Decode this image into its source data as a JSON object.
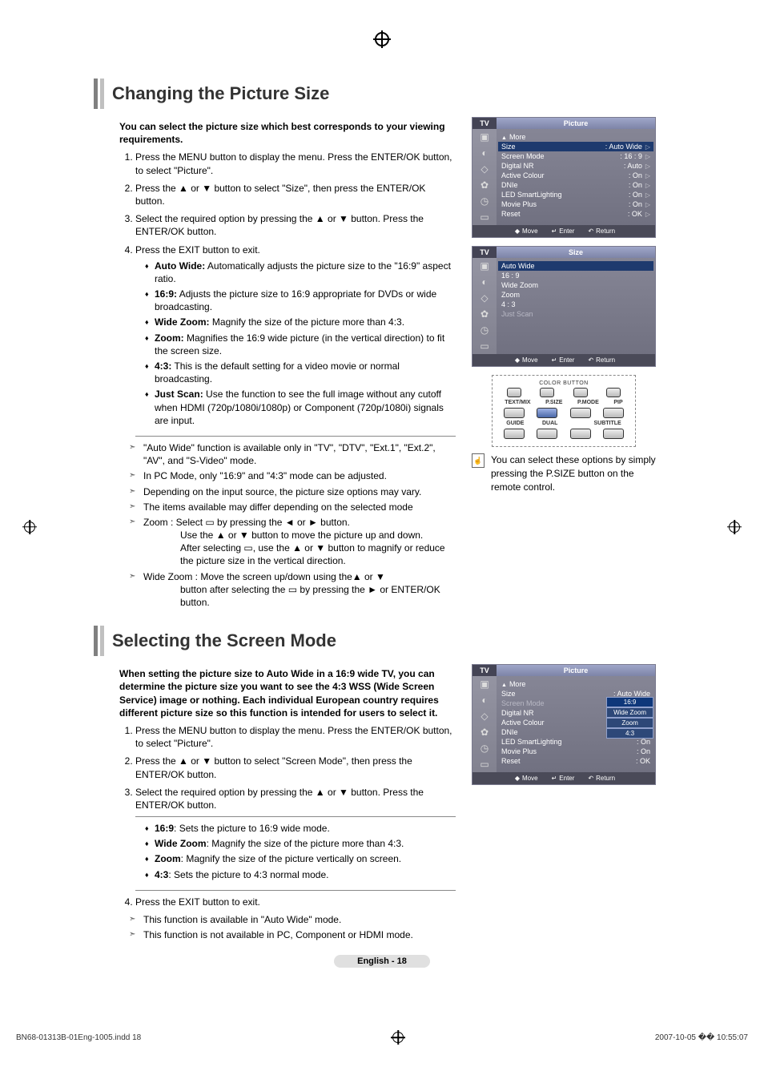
{
  "section1": {
    "title": "Changing the Picture Size",
    "lead": "You can select the picture size which best corresponds to your viewing requirements.",
    "steps": [
      {
        "num": "1.",
        "text": "Press the MENU button to display the menu. Press the ENTER/OK button, to select \"Picture\"."
      },
      {
        "num": "2.",
        "text": "Press the ▲ or ▼ button to select \"Size\", then press the ENTER/OK button."
      },
      {
        "num": "3.",
        "text": "Select the required option by pressing the ▲ or ▼ button. Press the ENTER/OK button."
      },
      {
        "num": "4.",
        "text": "Press the EXIT button to exit."
      }
    ],
    "options": [
      {
        "term": "Auto Wide:",
        "desc": "Automatically adjusts the picture size to the \"16:9\" aspect ratio."
      },
      {
        "term": "16:9:",
        "desc": "Adjusts the picture size to 16:9 appropriate for DVDs or wide broadcasting."
      },
      {
        "term": "Wide Zoom:",
        "desc": "Magnify the size of the picture more than 4:3."
      },
      {
        "term": "Zoom:",
        "desc": "Magnifies the 16:9 wide picture (in the vertical direction) to fit the screen size."
      },
      {
        "term": "4:3:",
        "desc": "This is the default setting for a video movie or normal broadcasting."
      },
      {
        "term": "Just Scan:",
        "desc": "Use the function to see the full image without any cutoff when HDMI (720p/1080i/1080p) or Component (720p/1080i) signals are input."
      }
    ],
    "notes": [
      "\"Auto Wide\" function is available only in \"TV\", \"DTV\",  \"Ext.1\", \"Ext.2\", \"AV\", and \"S-Video\" mode.",
      "In PC Mode, only \"16:9\" and \"4:3\" mode can be adjusted.",
      "Depending on the input source, the picture size options may vary.",
      "The items available may differ depending on the selected mode",
      "Zoom : Select ▭ by pressing the ◄ or ► button.",
      "Wide Zoom : Move the screen up/down using the▲ or ▼"
    ],
    "zoom_extra1": "Use the ▲ or ▼ button to move the picture up and down.",
    "zoom_extra2": "After selecting ▭, use the ▲ or ▼ button to magnify or reduce the picture size in the vertical direction.",
    "widezoom_extra": "button after selecting the ▭ by pressing the ► or ENTER/OK button."
  },
  "osd1": {
    "tab": "TV",
    "title": "Picture",
    "more": "More",
    "rows": [
      {
        "lbl": "Size",
        "val": "Auto Wide"
      },
      {
        "lbl": "Screen Mode",
        "val": "16 : 9"
      },
      {
        "lbl": "Digital NR",
        "val": "Auto"
      },
      {
        "lbl": "Active Colour",
        "val": "On"
      },
      {
        "lbl": "DNIe",
        "val": "On"
      },
      {
        "lbl": "LED SmartLighting",
        "val": "On"
      },
      {
        "lbl": "Movie Plus",
        "val": "On"
      },
      {
        "lbl": "Reset",
        "val": "OK"
      }
    ],
    "foot_move": "Move",
    "foot_enter": "Enter",
    "foot_return": "Return"
  },
  "osd2": {
    "tab": "TV",
    "title": "Size",
    "rows": [
      "Auto Wide",
      "16 : 9",
      "Wide Zoom",
      "Zoom",
      "4 : 3",
      "Just Scan"
    ],
    "foot_move": "Move",
    "foot_enter": "Enter",
    "foot_return": "Return"
  },
  "remote": {
    "legend": "COLOR BUTTON",
    "labels": [
      "TEXT/MIX",
      "P.SIZE",
      "P.MODE",
      "PIP"
    ],
    "labels2": [
      "GUIDE",
      "DUAL",
      "",
      "SUBTITLE"
    ]
  },
  "psize_note": "You can select these options by simply pressing the P.SIZE button on the remote control.",
  "section2": {
    "title": "Selecting the Screen Mode",
    "lead": "When setting the picture size to Auto Wide in a 16:9 wide TV, you can determine the picture size you want to see the 4:3 WSS (Wide Screen Service) image or nothing. Each individual European country requires different picture size so this function is intended for users to select it.",
    "steps": [
      {
        "num": "1.",
        "text": "Press the MENU button to display the menu. Press the ENTER/OK button, to select \"Picture\"."
      },
      {
        "num": "2.",
        "text": "Press the ▲ or ▼ button to select \"Screen Mode\", then press the ENTER/OK button."
      },
      {
        "num": "3.",
        "text": "Select the required option by pressing the ▲ or ▼ button. Press the ENTER/OK button."
      }
    ],
    "options": [
      {
        "term": "16:9",
        "desc": ": Sets the picture to 16:9 wide mode."
      },
      {
        "term": "Wide Zoom",
        "desc": ": Magnify the size of the picture more than 4:3."
      },
      {
        "term": "Zoom",
        "desc": ": Magnify the size of the picture vertically on screen."
      },
      {
        "term": "4:3",
        "desc": ": Sets the picture to 4:3 normal mode."
      }
    ],
    "step4": "Press the EXIT button to exit.",
    "notes": [
      "This function is available in \"Auto Wide\" mode.",
      "This function is not available in PC, Component or HDMI mode."
    ]
  },
  "osd3": {
    "tab": "TV",
    "title": "Picture",
    "more": "More",
    "rows": [
      {
        "lbl": "Size",
        "val": "Auto Wide"
      },
      {
        "lbl": "Screen Mode",
        "val": "16:9",
        "dropdown": [
          "16:9",
          "Wide Zoom",
          "Zoom",
          "4:3"
        ]
      },
      {
        "lbl": "Digital NR",
        "val": ""
      },
      {
        "lbl": "Active Colour",
        "val": ""
      },
      {
        "lbl": "DNIe",
        "val": ""
      },
      {
        "lbl": "LED SmartLighting",
        "val": "On"
      },
      {
        "lbl": "Movie Plus",
        "val": "On"
      },
      {
        "lbl": "Reset",
        "val": "OK"
      }
    ],
    "foot_move": "Move",
    "foot_enter": "Enter",
    "foot_return": "Return"
  },
  "page_num": "English - 18",
  "footer_left": "BN68-01313B-01Eng-1005.indd   18",
  "footer_right": "2007-10-05   �� 10:55:07"
}
